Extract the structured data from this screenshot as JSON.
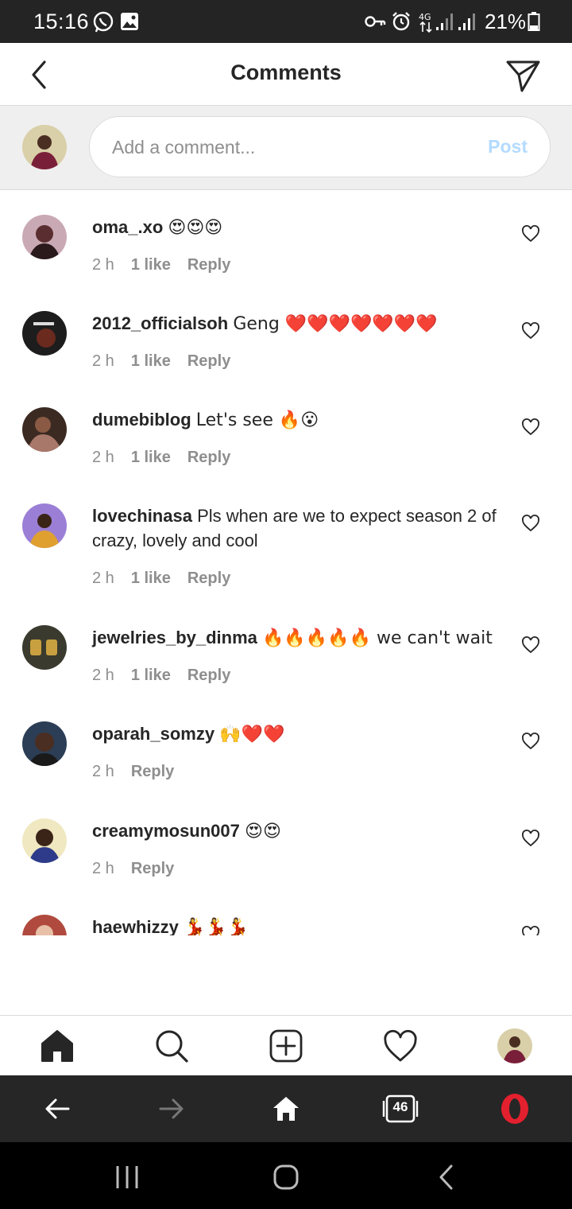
{
  "status_bar": {
    "time": "15:16",
    "battery": "21%"
  },
  "header": {
    "title": "Comments"
  },
  "composer": {
    "placeholder": "Add a comment...",
    "post_label": "Post"
  },
  "comments": [
    {
      "user": "oma_.xo",
      "text": "😍😍😍",
      "age": "2 h",
      "likes": "1 like",
      "reply": "Reply",
      "avatar_color": "#c9a9b4"
    },
    {
      "user": "2012_officialsoh",
      "text": "Geng ❤️❤️❤️❤️❤️❤️❤️",
      "age": "2 h",
      "likes": "1 like",
      "reply": "Reply",
      "avatar_color": "#1d1d1d"
    },
    {
      "user": "dumebiblog",
      "text": "Let's see 🔥😮",
      "age": "2 h",
      "likes": "1 like",
      "reply": "Reply",
      "avatar_color": "#6b4a3d"
    },
    {
      "user": "lovechinasa",
      "text": "Pls when are we to expect season 2 of crazy, lovely and cool",
      "age": "2 h",
      "likes": "1 like",
      "reply": "Reply",
      "avatar_color": "#9b7fd6"
    },
    {
      "user": "jewelries_by_dinma",
      "text": "🔥🔥🔥🔥🔥 we can't wait",
      "age": "2 h",
      "likes": "1 like",
      "reply": "Reply",
      "avatar_color": "#3a3a2e"
    },
    {
      "user": "oparah_somzy",
      "text": "🙌❤️❤️",
      "age": "2 h",
      "likes": "",
      "reply": "Reply",
      "avatar_color": "#2c3e55"
    },
    {
      "user": "creamymosun007",
      "text": "😍😍",
      "age": "2 h",
      "likes": "",
      "reply": "Reply",
      "avatar_color": "#2d3b8a"
    },
    {
      "user": "haewhizzy",
      "text": "💃💃💃",
      "age": "",
      "likes": "",
      "reply": "",
      "avatar_color": "#b04a3e"
    }
  ],
  "browser": {
    "tabs_count": "46"
  },
  "colors": {
    "post_disabled": "#b3dbff",
    "heart": "#262626",
    "opera_red": "#e3202e"
  }
}
